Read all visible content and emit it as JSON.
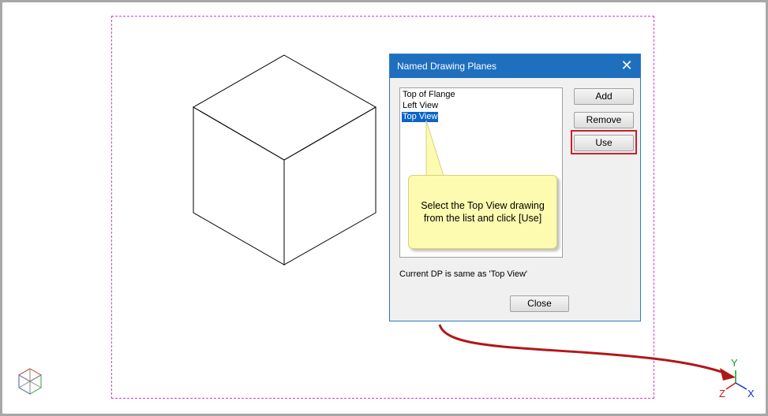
{
  "dialog": {
    "title": "Named Drawing Planes",
    "close_symbol": "✕",
    "list_items": [
      "Top of Flange",
      "Left View",
      "Top View"
    ],
    "selected_item": "Top View",
    "buttons": {
      "add": "Add",
      "remove": "Remove",
      "use": "Use",
      "close": "Close"
    },
    "status": "Current DP is same as 'Top View'"
  },
  "callout": {
    "line1": "Select the Top View drawing",
    "line2": "from the list and click [Use]"
  },
  "axes": {
    "y": "Y",
    "x": "X",
    "z": "Z"
  },
  "colors": {
    "dialog_title": "#1f6fbf",
    "selection": "#0a64c8",
    "highlight": "#c8202a",
    "callout": "#fdfbb0",
    "arrow": "#b01818",
    "page_boundary": "#d040d0",
    "axis_x": "#1030d0",
    "axis_y": "#10a020",
    "axis_z": "#d01818"
  },
  "icons": [
    "view-cube-icon",
    "close-icon",
    "ucs-axes-icon"
  ]
}
